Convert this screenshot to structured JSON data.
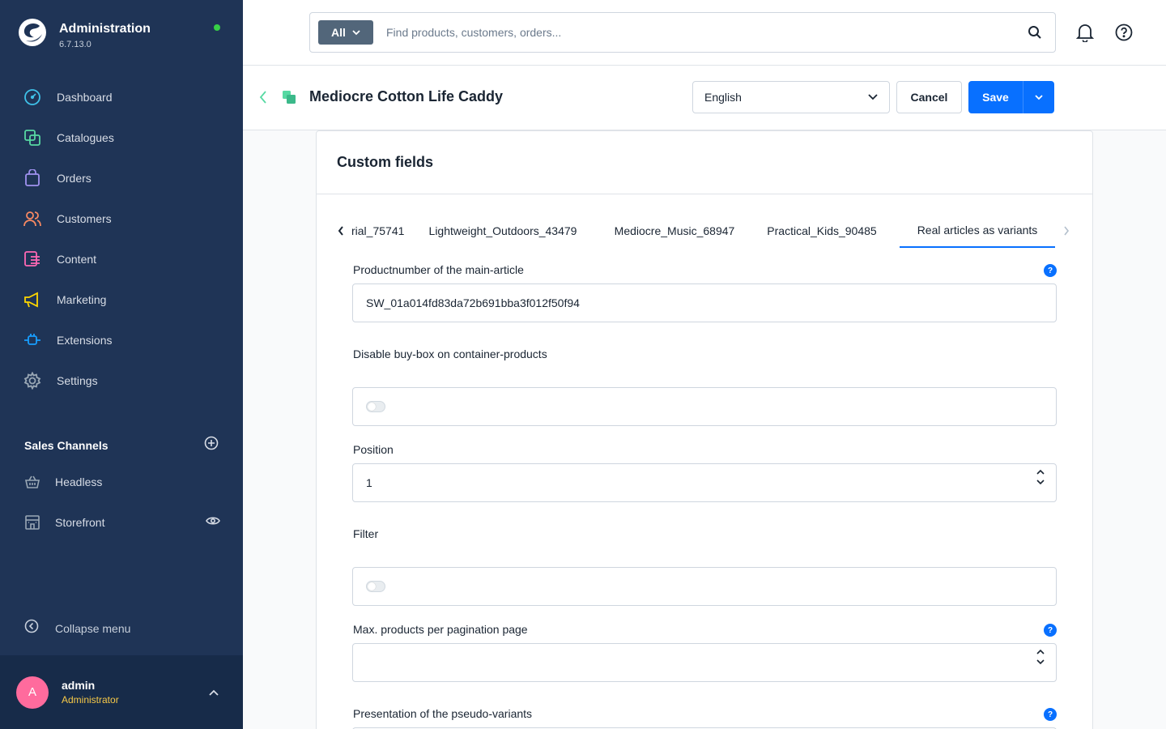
{
  "app": {
    "title": "Administration",
    "version": "6.7.13.0"
  },
  "nav": {
    "items": [
      {
        "label": "Dashboard",
        "icon": "dashboard-icon",
        "color": "#3fc1e8"
      },
      {
        "label": "Catalogues",
        "icon": "catalogues-icon",
        "color": "#57d9a3"
      },
      {
        "label": "Orders",
        "icon": "orders-icon",
        "color": "#a092f0"
      },
      {
        "label": "Customers",
        "icon": "customers-icon",
        "color": "#f88962"
      },
      {
        "label": "Content",
        "icon": "content-icon",
        "color": "#ff68b4"
      },
      {
        "label": "Marketing",
        "icon": "marketing-icon",
        "color": "#ffd700"
      },
      {
        "label": "Extensions",
        "icon": "extensions-icon",
        "color": "#189eff"
      },
      {
        "label": "Settings",
        "icon": "settings-icon",
        "color": "#9aa8b5"
      }
    ]
  },
  "sales_channels": {
    "title": "Sales Channels",
    "items": [
      {
        "label": "Headless",
        "icon": "basket-icon"
      },
      {
        "label": "Storefront",
        "icon": "storefront-icon"
      }
    ]
  },
  "collapse_label": "Collapse menu",
  "user": {
    "initial": "A",
    "name": "admin",
    "role": "Administrator"
  },
  "search": {
    "type_label": "All",
    "placeholder": "Find products, customers, orders..."
  },
  "smartbar": {
    "title": "Mediocre Cotton Life Caddy",
    "language": "English",
    "cancel_label": "Cancel",
    "save_label": "Save"
  },
  "card": {
    "title": "Custom fields",
    "tabs": [
      {
        "label": "rial_75741",
        "active": false
      },
      {
        "label": "Lightweight_Outdoors_43479",
        "active": false
      },
      {
        "label": "Mediocre_Music_68947",
        "active": false
      },
      {
        "label": "Practical_Kids_90485",
        "active": false
      },
      {
        "label": "Real articles as variants",
        "active": true
      }
    ],
    "fields": {
      "main_article": {
        "label": "Productnumber of the main-article",
        "value": "SW_01a014fd83da72b691bba3f012f50f94"
      },
      "disable_buybox": {
        "label": "Disable buy-box on container-products",
        "checked": false
      },
      "position": {
        "label": "Position",
        "value": "1"
      },
      "filter": {
        "label": "Filter",
        "checked": false
      },
      "max_products": {
        "label": "Max. products per pagination page",
        "value": ""
      },
      "presentation": {
        "label": "Presentation of the pseudo-variants"
      }
    },
    "help_glyph": "?"
  },
  "colors": {
    "sidebar_bg": "#1f3456",
    "accent": "#0870ff",
    "status_online": "#37d046",
    "role_text": "#f7c948"
  }
}
